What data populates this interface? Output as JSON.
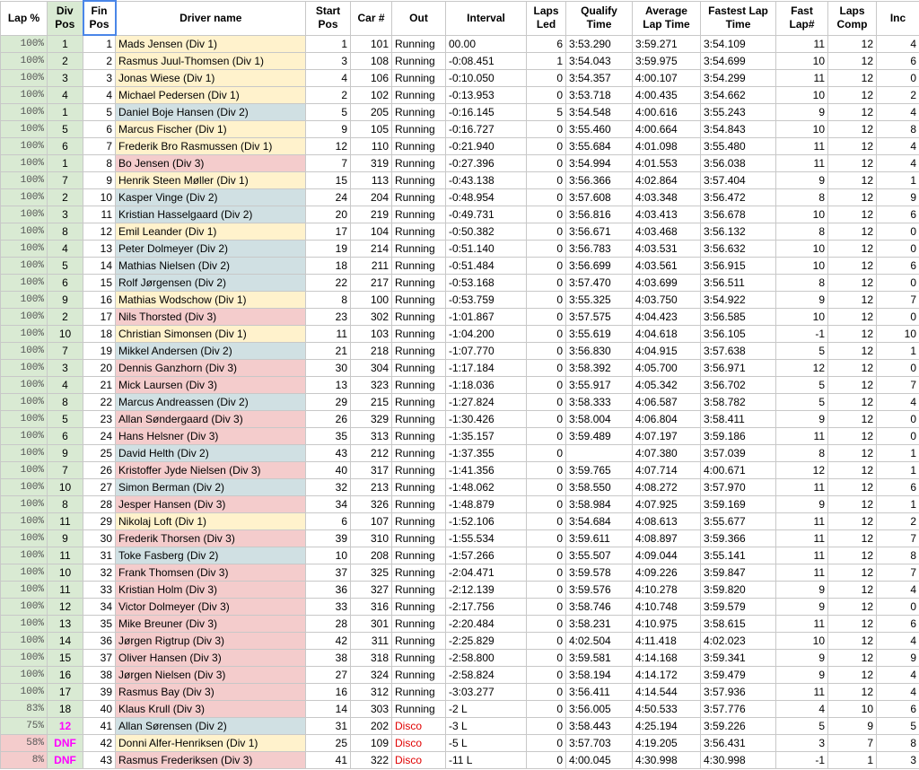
{
  "headers": {
    "lap_pct": "Lap %",
    "div_pos": "Div Pos",
    "fin_pos": "Fin Pos",
    "driver": "Driver name",
    "start": "Start Pos",
    "car": "Car #",
    "out": "Out",
    "interval": "Interval",
    "laps_led": "Laps Led",
    "qualify": "Qualify Time",
    "avg": "Average Lap Time",
    "fastest": "Fastest Lap Time",
    "fast_lap": "Fast Lap#",
    "comp": "Laps Comp",
    "inc": "Inc"
  },
  "colors": {
    "div1": "#fff2cc",
    "div2": "#d0e0e3",
    "div3": "#f4cccc",
    "lap_green": "#d9ead3",
    "lap_partial": "#f4cccc",
    "magenta": "#ff00ff",
    "disco_red": "#e00000"
  },
  "rows": [
    {
      "lap": "100%",
      "div_pos": "1",
      "fin": "1",
      "name": "Mads Jensen (Div 1)",
      "div": 1,
      "start": "1",
      "car": "101",
      "out": "Running",
      "interval": "00.00",
      "led": "6",
      "qual": "3:53.290",
      "avg": "3:59.271",
      "fast": "3:54.109",
      "fastlap": "11",
      "comp": "12",
      "inc": "4"
    },
    {
      "lap": "100%",
      "div_pos": "2",
      "fin": "2",
      "name": "Rasmus Juul-Thomsen (Div 1)",
      "div": 1,
      "start": "3",
      "car": "108",
      "out": "Running",
      "interval": "-0:08.451",
      "led": "1",
      "qual": "3:54.043",
      "avg": "3:59.975",
      "fast": "3:54.699",
      "fastlap": "10",
      "comp": "12",
      "inc": "6"
    },
    {
      "lap": "100%",
      "div_pos": "3",
      "fin": "3",
      "name": "Jonas Wiese (Div 1)",
      "div": 1,
      "start": "4",
      "car": "106",
      "out": "Running",
      "interval": "-0:10.050",
      "led": "0",
      "qual": "3:54.357",
      "avg": "4:00.107",
      "fast": "3:54.299",
      "fastlap": "11",
      "comp": "12",
      "inc": "0"
    },
    {
      "lap": "100%",
      "div_pos": "4",
      "fin": "4",
      "name": "Michael Pedersen (Div 1)",
      "div": 1,
      "start": "2",
      "car": "102",
      "out": "Running",
      "interval": "-0:13.953",
      "led": "0",
      "qual": "3:53.718",
      "avg": "4:00.435",
      "fast": "3:54.662",
      "fastlap": "10",
      "comp": "12",
      "inc": "2"
    },
    {
      "lap": "100%",
      "div_pos": "1",
      "fin": "5",
      "name": "Daniel Boje Hansen (Div 2)",
      "div": 2,
      "start": "5",
      "car": "205",
      "out": "Running",
      "interval": "-0:16.145",
      "led": "5",
      "qual": "3:54.548",
      "avg": "4:00.616",
      "fast": "3:55.243",
      "fastlap": "9",
      "comp": "12",
      "inc": "4"
    },
    {
      "lap": "100%",
      "div_pos": "5",
      "fin": "6",
      "name": "Marcus Fischer (Div 1)",
      "div": 1,
      "start": "9",
      "car": "105",
      "out": "Running",
      "interval": "-0:16.727",
      "led": "0",
      "qual": "3:55.460",
      "avg": "4:00.664",
      "fast": "3:54.843",
      "fastlap": "10",
      "comp": "12",
      "inc": "8"
    },
    {
      "lap": "100%",
      "div_pos": "6",
      "fin": "7",
      "name": "Frederik Bro Rasmussen (Div 1)",
      "div": 1,
      "start": "12",
      "car": "110",
      "out": "Running",
      "interval": "-0:21.940",
      "led": "0",
      "qual": "3:55.684",
      "avg": "4:01.098",
      "fast": "3:55.480",
      "fastlap": "11",
      "comp": "12",
      "inc": "4"
    },
    {
      "lap": "100%",
      "div_pos": "1",
      "fin": "8",
      "name": "Bo Jensen (Div 3)",
      "div": 3,
      "start": "7",
      "car": "319",
      "out": "Running",
      "interval": "-0:27.396",
      "led": "0",
      "qual": "3:54.994",
      "avg": "4:01.553",
      "fast": "3:56.038",
      "fastlap": "11",
      "comp": "12",
      "inc": "4"
    },
    {
      "lap": "100%",
      "div_pos": "7",
      "fin": "9",
      "name": "Henrik Steen Møller (Div 1)",
      "div": 1,
      "start": "15",
      "car": "113",
      "out": "Running",
      "interval": "-0:43.138",
      "led": "0",
      "qual": "3:56.366",
      "avg": "4:02.864",
      "fast": "3:57.404",
      "fastlap": "9",
      "comp": "12",
      "inc": "1"
    },
    {
      "lap": "100%",
      "div_pos": "2",
      "fin": "10",
      "name": "Kasper Vinge (Div 2)",
      "div": 2,
      "start": "24",
      "car": "204",
      "out": "Running",
      "interval": "-0:48.954",
      "led": "0",
      "qual": "3:57.608",
      "avg": "4:03.348",
      "fast": "3:56.472",
      "fastlap": "8",
      "comp": "12",
      "inc": "9"
    },
    {
      "lap": "100%",
      "div_pos": "3",
      "fin": "11",
      "name": "Kristian Hasselgaard (Div 2)",
      "div": 2,
      "start": "20",
      "car": "219",
      "out": "Running",
      "interval": "-0:49.731",
      "led": "0",
      "qual": "3:56.816",
      "avg": "4:03.413",
      "fast": "3:56.678",
      "fastlap": "10",
      "comp": "12",
      "inc": "6"
    },
    {
      "lap": "100%",
      "div_pos": "8",
      "fin": "12",
      "name": "Emil Leander (Div 1)",
      "div": 1,
      "start": "17",
      "car": "104",
      "out": "Running",
      "interval": "-0:50.382",
      "led": "0",
      "qual": "3:56.671",
      "avg": "4:03.468",
      "fast": "3:56.132",
      "fastlap": "8",
      "comp": "12",
      "inc": "0"
    },
    {
      "lap": "100%",
      "div_pos": "4",
      "fin": "13",
      "name": "Peter Dolmeyer (Div 2)",
      "div": 2,
      "start": "19",
      "car": "214",
      "out": "Running",
      "interval": "-0:51.140",
      "led": "0",
      "qual": "3:56.783",
      "avg": "4:03.531",
      "fast": "3:56.632",
      "fastlap": "10",
      "comp": "12",
      "inc": "0"
    },
    {
      "lap": "100%",
      "div_pos": "5",
      "fin": "14",
      "name": "Mathias Nielsen (Div 2)",
      "div": 2,
      "start": "18",
      "car": "211",
      "out": "Running",
      "interval": "-0:51.484",
      "led": "0",
      "qual": "3:56.699",
      "avg": "4:03.561",
      "fast": "3:56.915",
      "fastlap": "10",
      "comp": "12",
      "inc": "6"
    },
    {
      "lap": "100%",
      "div_pos": "6",
      "fin": "15",
      "name": "Rolf Jørgensen (Div 2)",
      "div": 2,
      "start": "22",
      "car": "217",
      "out": "Running",
      "interval": "-0:53.168",
      "led": "0",
      "qual": "3:57.470",
      "avg": "4:03.699",
      "fast": "3:56.511",
      "fastlap": "8",
      "comp": "12",
      "inc": "0"
    },
    {
      "lap": "100%",
      "div_pos": "9",
      "fin": "16",
      "name": "Mathias Wodschow (Div 1)",
      "div": 1,
      "start": "8",
      "car": "100",
      "out": "Running",
      "interval": "-0:53.759",
      "led": "0",
      "qual": "3:55.325",
      "avg": "4:03.750",
      "fast": "3:54.922",
      "fastlap": "9",
      "comp": "12",
      "inc": "7"
    },
    {
      "lap": "100%",
      "div_pos": "2",
      "fin": "17",
      "name": "Nils Thorsted (Div 3)",
      "div": 3,
      "start": "23",
      "car": "302",
      "out": "Running",
      "interval": "-1:01.867",
      "led": "0",
      "qual": "3:57.575",
      "avg": "4:04.423",
      "fast": "3:56.585",
      "fastlap": "10",
      "comp": "12",
      "inc": "0"
    },
    {
      "lap": "100%",
      "div_pos": "10",
      "fin": "18",
      "name": "Christian Simonsen (Div 1)",
      "div": 1,
      "start": "11",
      "car": "103",
      "out": "Running",
      "interval": "-1:04.200",
      "led": "0",
      "qual": "3:55.619",
      "avg": "4:04.618",
      "fast": "3:56.105",
      "fastlap": "-1",
      "comp": "12",
      "inc": "10"
    },
    {
      "lap": "100%",
      "div_pos": "7",
      "fin": "19",
      "name": "Mikkel Andersen (Div 2)",
      "div": 2,
      "start": "21",
      "car": "218",
      "out": "Running",
      "interval": "-1:07.770",
      "led": "0",
      "qual": "3:56.830",
      "avg": "4:04.915",
      "fast": "3:57.638",
      "fastlap": "5",
      "comp": "12",
      "inc": "1"
    },
    {
      "lap": "100%",
      "div_pos": "3",
      "fin": "20",
      "name": "Dennis Ganzhorn (Div 3)",
      "div": 3,
      "start": "30",
      "car": "304",
      "out": "Running",
      "interval": "-1:17.184",
      "led": "0",
      "qual": "3:58.392",
      "avg": "4:05.700",
      "fast": "3:56.971",
      "fastlap": "12",
      "comp": "12",
      "inc": "0"
    },
    {
      "lap": "100%",
      "div_pos": "4",
      "fin": "21",
      "name": "Mick Laursen (Div 3)",
      "div": 3,
      "start": "13",
      "car": "323",
      "out": "Running",
      "interval": "-1:18.036",
      "led": "0",
      "qual": "3:55.917",
      "avg": "4:05.342",
      "fast": "3:56.702",
      "fastlap": "5",
      "comp": "12",
      "inc": "7"
    },
    {
      "lap": "100%",
      "div_pos": "8",
      "fin": "22",
      "name": "Marcus Andreassen (Div 2)",
      "div": 2,
      "start": "29",
      "car": "215",
      "out": "Running",
      "interval": "-1:27.824",
      "led": "0",
      "qual": "3:58.333",
      "avg": "4:06.587",
      "fast": "3:58.782",
      "fastlap": "5",
      "comp": "12",
      "inc": "4"
    },
    {
      "lap": "100%",
      "div_pos": "5",
      "fin": "23",
      "name": "Allan Søndergaard (Div 3)",
      "div": 3,
      "start": "26",
      "car": "329",
      "out": "Running",
      "interval": "-1:30.426",
      "led": "0",
      "qual": "3:58.004",
      "avg": "4:06.804",
      "fast": "3:58.411",
      "fastlap": "9",
      "comp": "12",
      "inc": "0"
    },
    {
      "lap": "100%",
      "div_pos": "6",
      "fin": "24",
      "name": "Hans Helsner (Div 3)",
      "div": 3,
      "start": "35",
      "car": "313",
      "out": "Running",
      "interval": "-1:35.157",
      "led": "0",
      "qual": "3:59.489",
      "avg": "4:07.197",
      "fast": "3:59.186",
      "fastlap": "11",
      "comp": "12",
      "inc": "0"
    },
    {
      "lap": "100%",
      "div_pos": "9",
      "fin": "25",
      "name": "David Helth (Div 2)",
      "div": 2,
      "start": "43",
      "car": "212",
      "out": "Running",
      "interval": "-1:37.355",
      "led": "0",
      "qual": "",
      "avg": "4:07.380",
      "fast": "3:57.039",
      "fastlap": "8",
      "comp": "12",
      "inc": "1"
    },
    {
      "lap": "100%",
      "div_pos": "7",
      "fin": "26",
      "name": "Kristoffer Jyde Nielsen (Div 3)",
      "div": 3,
      "start": "40",
      "car": "317",
      "out": "Running",
      "interval": "-1:41.356",
      "led": "0",
      "qual": "3:59.765",
      "avg": "4:07.714",
      "fast": "4:00.671",
      "fastlap": "12",
      "comp": "12",
      "inc": "1"
    },
    {
      "lap": "100%",
      "div_pos": "10",
      "fin": "27",
      "name": "Simon Berman (Div 2)",
      "div": 2,
      "start": "32",
      "car": "213",
      "out": "Running",
      "interval": "-1:48.062",
      "led": "0",
      "qual": "3:58.550",
      "avg": "4:08.272",
      "fast": "3:57.970",
      "fastlap": "11",
      "comp": "12",
      "inc": "6"
    },
    {
      "lap": "100%",
      "div_pos": "8",
      "fin": "28",
      "name": "Jesper Hansen (Div 3)",
      "div": 3,
      "start": "34",
      "car": "326",
      "out": "Running",
      "interval": "-1:48.879",
      "led": "0",
      "qual": "3:58.984",
      "avg": "4:07.925",
      "fast": "3:59.169",
      "fastlap": "9",
      "comp": "12",
      "inc": "1"
    },
    {
      "lap": "100%",
      "div_pos": "11",
      "fin": "29",
      "name": "Nikolaj Loft (Div 1)",
      "div": 1,
      "start": "6",
      "car": "107",
      "out": "Running",
      "interval": "-1:52.106",
      "led": "0",
      "qual": "3:54.684",
      "avg": "4:08.613",
      "fast": "3:55.677",
      "fastlap": "11",
      "comp": "12",
      "inc": "2"
    },
    {
      "lap": "100%",
      "div_pos": "9",
      "fin": "30",
      "name": "Frederik Thorsen (Div 3)",
      "div": 3,
      "start": "39",
      "car": "310",
      "out": "Running",
      "interval": "-1:55.534",
      "led": "0",
      "qual": "3:59.611",
      "avg": "4:08.897",
      "fast": "3:59.366",
      "fastlap": "11",
      "comp": "12",
      "inc": "7"
    },
    {
      "lap": "100%",
      "div_pos": "11",
      "fin": "31",
      "name": "Toke Fasberg (Div 2)",
      "div": 2,
      "start": "10",
      "car": "208",
      "out": "Running",
      "interval": "-1:57.266",
      "led": "0",
      "qual": "3:55.507",
      "avg": "4:09.044",
      "fast": "3:55.141",
      "fastlap": "11",
      "comp": "12",
      "inc": "8"
    },
    {
      "lap": "100%",
      "div_pos": "10",
      "fin": "32",
      "name": "Frank Thomsen (Div 3)",
      "div": 3,
      "start": "37",
      "car": "325",
      "out": "Running",
      "interval": "-2:04.471",
      "led": "0",
      "qual": "3:59.578",
      "avg": "4:09.226",
      "fast": "3:59.847",
      "fastlap": "11",
      "comp": "12",
      "inc": "7"
    },
    {
      "lap": "100%",
      "div_pos": "11",
      "fin": "33",
      "name": "Kristian Holm (Div 3)",
      "div": 3,
      "start": "36",
      "car": "327",
      "out": "Running",
      "interval": "-2:12.139",
      "led": "0",
      "qual": "3:59.576",
      "avg": "4:10.278",
      "fast": "3:59.820",
      "fastlap": "9",
      "comp": "12",
      "inc": "4"
    },
    {
      "lap": "100%",
      "div_pos": "12",
      "fin": "34",
      "name": "Victor Dolmeyer (Div 3)",
      "div": 3,
      "start": "33",
      "car": "316",
      "out": "Running",
      "interval": "-2:17.756",
      "led": "0",
      "qual": "3:58.746",
      "avg": "4:10.748",
      "fast": "3:59.579",
      "fastlap": "9",
      "comp": "12",
      "inc": "0"
    },
    {
      "lap": "100%",
      "div_pos": "13",
      "fin": "35",
      "name": "Mike Breuner (Div 3)",
      "div": 3,
      "start": "28",
      "car": "301",
      "out": "Running",
      "interval": "-2:20.484",
      "led": "0",
      "qual": "3:58.231",
      "avg": "4:10.975",
      "fast": "3:58.615",
      "fastlap": "11",
      "comp": "12",
      "inc": "6"
    },
    {
      "lap": "100%",
      "div_pos": "14",
      "fin": "36",
      "name": "Jørgen Rigtrup (Div 3)",
      "div": 3,
      "start": "42",
      "car": "311",
      "out": "Running",
      "interval": "-2:25.829",
      "led": "0",
      "qual": "4:02.504",
      "avg": "4:11.418",
      "fast": "4:02.023",
      "fastlap": "10",
      "comp": "12",
      "inc": "4"
    },
    {
      "lap": "100%",
      "div_pos": "15",
      "fin": "37",
      "name": "Oliver Hansen (Div 3)",
      "div": 3,
      "start": "38",
      "car": "318",
      "out": "Running",
      "interval": "-2:58.800",
      "led": "0",
      "qual": "3:59.581",
      "avg": "4:14.168",
      "fast": "3:59.341",
      "fastlap": "9",
      "comp": "12",
      "inc": "9"
    },
    {
      "lap": "100%",
      "div_pos": "16",
      "fin": "38",
      "name": "Jørgen Nielsen (Div 3)",
      "div": 3,
      "start": "27",
      "car": "324",
      "out": "Running",
      "interval": "-2:58.824",
      "led": "0",
      "qual": "3:58.194",
      "avg": "4:14.172",
      "fast": "3:59.479",
      "fastlap": "9",
      "comp": "12",
      "inc": "4"
    },
    {
      "lap": "100%",
      "div_pos": "17",
      "fin": "39",
      "name": "Rasmus Bay (Div 3)",
      "div": 3,
      "start": "16",
      "car": "312",
      "out": "Running",
      "interval": "-3:03.277",
      "led": "0",
      "qual": "3:56.411",
      "avg": "4:14.544",
      "fast": "3:57.936",
      "fastlap": "11",
      "comp": "12",
      "inc": "4"
    },
    {
      "lap": "83%",
      "div_pos": "18",
      "fin": "40",
      "name": "Klaus Krull (Div 3)",
      "div": 3,
      "start": "14",
      "car": "303",
      "out": "Running",
      "interval": "-2 L",
      "led": "0",
      "qual": "3:56.005",
      "avg": "4:50.533",
      "fast": "3:57.776",
      "fastlap": "4",
      "comp": "10",
      "inc": "6"
    },
    {
      "lap": "75%",
      "div_pos": "12",
      "fin": "41",
      "name": "Allan Sørensen (Div 2)",
      "div": 2,
      "start": "31",
      "car": "202",
      "out": "Disco",
      "interval": "-3 L",
      "led": "0",
      "qual": "3:58.443",
      "avg": "4:25.194",
      "fast": "3:59.226",
      "fastlap": "5",
      "comp": "9",
      "inc": "5",
      "magenta": true
    },
    {
      "lap": "58%",
      "div_pos": "DNF",
      "fin": "42",
      "name": "Donni Alfer-Henriksen (Div 1)",
      "div": 1,
      "start": "25",
      "car": "109",
      "out": "Disco",
      "interval": "-5 L",
      "led": "0",
      "qual": "3:57.703",
      "avg": "4:19.205",
      "fast": "3:56.431",
      "fastlap": "3",
      "comp": "7",
      "inc": "8",
      "magenta": true,
      "partial": true
    },
    {
      "lap": "8%",
      "div_pos": "DNF",
      "fin": "43",
      "name": "Rasmus Frederiksen (Div 3)",
      "div": 3,
      "start": "41",
      "car": "322",
      "out": "Disco",
      "interval": "-11 L",
      "led": "0",
      "qual": "4:00.045",
      "avg": "4:30.998",
      "fast": "4:30.998",
      "fastlap": "-1",
      "comp": "1",
      "inc": "3",
      "magenta": true,
      "partial": true
    }
  ]
}
